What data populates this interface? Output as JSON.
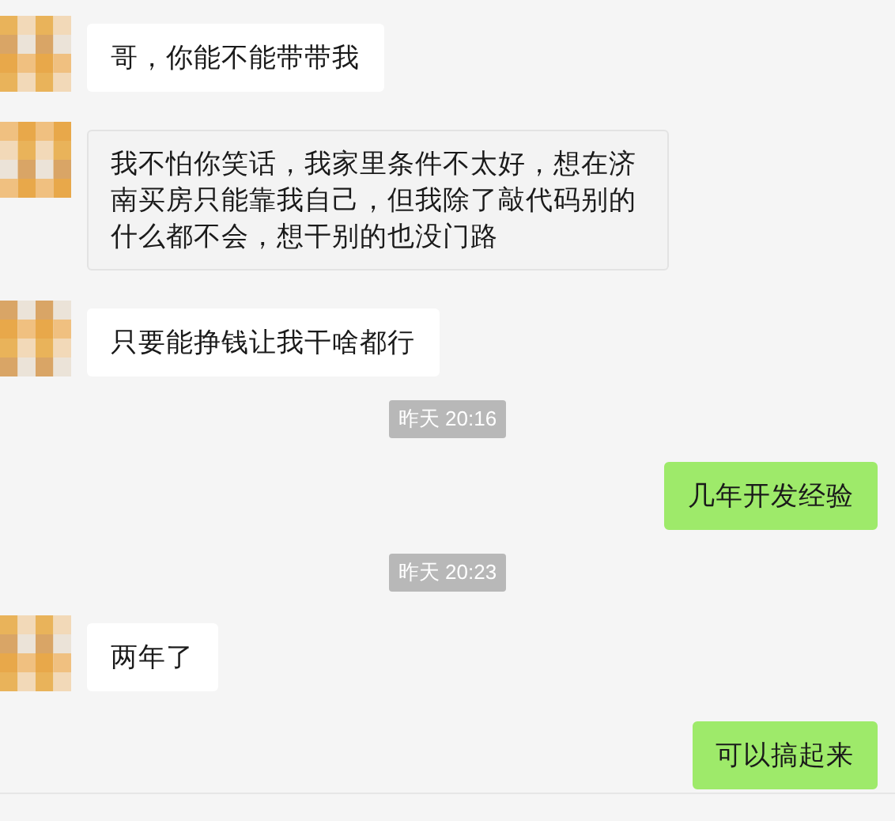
{
  "messages": [
    {
      "kind": "incoming",
      "text": "哥，你能不能带带我",
      "highlighted": false
    },
    {
      "kind": "incoming",
      "text": "我不怕你笑话，我家里条件不太好，想在济南买房只能靠我自己，但我除了敲代码别的什么都不会，想干别的也没门路",
      "highlighted": true
    },
    {
      "kind": "incoming",
      "text": "只要能挣钱让我干啥都行",
      "highlighted": false
    },
    {
      "kind": "timestamp",
      "text": "昨天 20:16"
    },
    {
      "kind": "outgoing",
      "text": "几年开发经验"
    },
    {
      "kind": "timestamp",
      "text": "昨天 20:23"
    },
    {
      "kind": "incoming",
      "text": "两年了",
      "highlighted": false
    },
    {
      "kind": "outgoing",
      "text": "可以搞起来"
    }
  ]
}
